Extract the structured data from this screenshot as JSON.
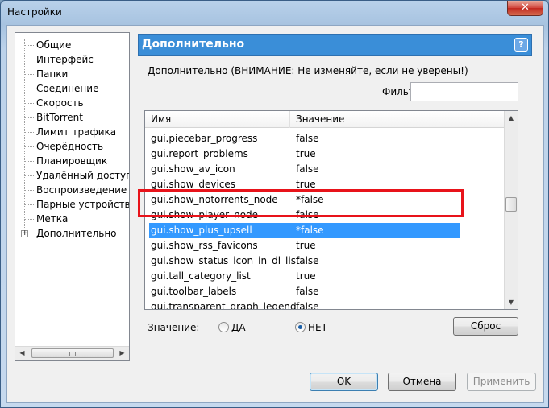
{
  "window": {
    "title": "Настройки",
    "close_glyph": "✕"
  },
  "tree": {
    "items": [
      {
        "label": "Общие"
      },
      {
        "label": "Интерфейс"
      },
      {
        "label": "Папки"
      },
      {
        "label": "Соединение"
      },
      {
        "label": "Скорость"
      },
      {
        "label": "BitTorrent"
      },
      {
        "label": "Лимит трафика"
      },
      {
        "label": "Очерёдность"
      },
      {
        "label": "Планировщик"
      },
      {
        "label": "Удалённый доступ"
      },
      {
        "label": "Воспроизведение"
      },
      {
        "label": "Парные устройства"
      },
      {
        "label": "Метка"
      },
      {
        "label": "Дополнительно",
        "expand": "+"
      }
    ]
  },
  "panel": {
    "title": "Дополнительно",
    "help": "?",
    "group_label": "Дополнительно (ВНИМАНИЕ: Не изменяйте, если не уверены!)",
    "filter_label": "Фильт",
    "filter_value": ""
  },
  "list": {
    "columns": [
      "Имя",
      "Значение"
    ],
    "rows": [
      {
        "name": "gui.piecebar_progress",
        "value": "false"
      },
      {
        "name": "gui.report_problems",
        "value": "true"
      },
      {
        "name": "gui.show_av_icon",
        "value": "false"
      },
      {
        "name": "gui.show_devices",
        "value": "true"
      },
      {
        "name": "gui.show_notorrents_node",
        "value": "*false"
      },
      {
        "name": "gui.show_player_node",
        "value": "false"
      },
      {
        "name": "gui.show_plus_upsell",
        "value": "*false",
        "selected": true
      },
      {
        "name": "gui.show_rss_favicons",
        "value": "true"
      },
      {
        "name": "gui.show_status_icon_in_dl_list",
        "value": "false"
      },
      {
        "name": "gui.tall_category_list",
        "value": "true"
      },
      {
        "name": "gui.toolbar_labels",
        "value": "false"
      },
      {
        "name": "gui.transparent_graph_legend",
        "value": "false"
      }
    ]
  },
  "value_editor": {
    "label": "Значение:",
    "option_yes": "ДА",
    "option_no": "НЕТ",
    "selected": "НЕТ",
    "reset_label": "Сброс"
  },
  "footer": {
    "ok_label": "OK",
    "cancel_label": "Отмена",
    "apply_label": "Применить"
  },
  "colors": {
    "header_blue": "#3a8ed8",
    "selection_blue": "#3399ff",
    "highlight_red": "#e8131a"
  }
}
